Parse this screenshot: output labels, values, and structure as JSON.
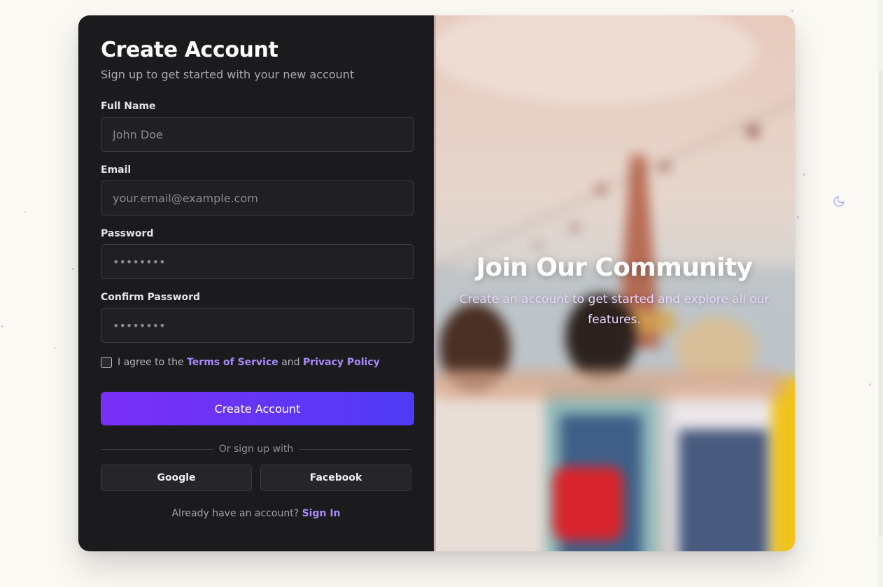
{
  "page": {
    "theme_toggle_icon": "moon-icon",
    "colors": {
      "accent": "#a78bfa",
      "button_gradient_start": "#7b2ff7",
      "button_gradient_end": "#4f3bf5",
      "panel_bg": "#1b1b1e",
      "page_bg": "#fbf9f4"
    }
  },
  "form": {
    "title": "Create Account",
    "subtitle": "Sign up to get started with your new account",
    "fields": [
      {
        "label": "Full Name",
        "placeholder": "John Doe",
        "value": ""
      },
      {
        "label": "Email",
        "placeholder": "your.email@example.com",
        "value": ""
      },
      {
        "label": "Password",
        "placeholder": "••••••••",
        "value": ""
      },
      {
        "label": "Confirm Password",
        "placeholder": "••••••••",
        "value": ""
      }
    ],
    "agree": {
      "prefix": "I agree to the ",
      "terms_link": "Terms of Service",
      "middle": " and ",
      "privacy_link": "Privacy Policy",
      "checked": false
    },
    "submit_label": "Create Account",
    "divider_text": "Or sign up with",
    "social": {
      "google_label": "Google",
      "facebook_label": "Facebook"
    },
    "signin": {
      "prompt": "Already have an account? ",
      "link": "Sign In"
    }
  },
  "hero": {
    "title": "Join Our Community",
    "subtitle": "Create an account to get started and explore all our features."
  }
}
